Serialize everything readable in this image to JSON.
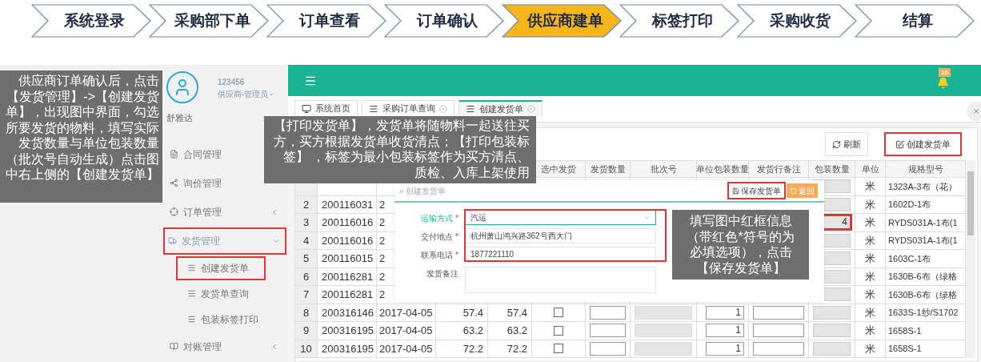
{
  "process_steps": [
    {
      "label": "系统登录",
      "selected": false
    },
    {
      "label": "采购部下单",
      "selected": false
    },
    {
      "label": "订单查看",
      "selected": false
    },
    {
      "label": "订单确认",
      "selected": false
    },
    {
      "label": "供应商建单",
      "selected": true
    },
    {
      "label": "标签打印",
      "selected": false
    },
    {
      "label": "采购收货",
      "selected": false
    },
    {
      "label": "结算",
      "selected": false
    }
  ],
  "user": {
    "id": "123456",
    "role": "供应商-管理员",
    "company": "舒雅达"
  },
  "sidebar": {
    "items": [
      {
        "label": "合同管理",
        "kind": "file",
        "expanded": false,
        "highlighted": false
      },
      {
        "label": "询价管理",
        "kind": "share",
        "expanded": false,
        "highlighted": false
      },
      {
        "label": "订单管理",
        "kind": "target",
        "collapsible": true,
        "expanded": false,
        "highlighted": false
      },
      {
        "label": "发货管理",
        "kind": "truck",
        "collapsible": true,
        "expanded": true,
        "highlighted": true,
        "children": [
          {
            "label": "创建发货单",
            "highlighted": true
          },
          {
            "label": "发货单查询",
            "highlighted": false
          },
          {
            "label": "包装标签打印",
            "highlighted": false
          }
        ]
      },
      {
        "label": "对账管理",
        "kind": "book",
        "collapsible": true,
        "expanded": false,
        "highlighted": false
      }
    ]
  },
  "header": {
    "notification_count": "10"
  },
  "tabs": [
    {
      "label": "系统首页",
      "kind": "home",
      "closable": false,
      "selected": false
    },
    {
      "label": "采购订单查询",
      "kind": "list",
      "closable": true,
      "selected": false
    },
    {
      "label": "创建发货单",
      "kind": "list",
      "closable": true,
      "selected": true
    }
  ],
  "toolbar": [
    {
      "label": "刷新",
      "kind": "refresh",
      "highlighted": false
    },
    {
      "label": "创建发货单",
      "kind": "edit",
      "highlighted": true
    }
  ],
  "table": {
    "columns": [
      {
        "label": "选中发货"
      },
      {
        "label": "发货数量"
      },
      {
        "label": "批次号"
      },
      {
        "label": "单位包装数量"
      },
      {
        "label": "发货行备注"
      },
      {
        "label": "包装数量"
      },
      {
        "label": "单位"
      },
      {
        "label": "规格型号"
      }
    ],
    "rows": [
      {
        "unit": "米",
        "spec": "1323A-3布（花）",
        "pack_highlighted": false
      },
      {
        "no": "2",
        "code": "200116031",
        "date": "2",
        "unit": "米",
        "spec": "1602D-1布",
        "pack_highlighted": false
      },
      {
        "no": "3",
        "code": "200116016",
        "date": "2",
        "pack_qty": "4",
        "unit": "米",
        "spec": "RYDS031A-1布(1",
        "pack_highlighted": true
      },
      {
        "no": "4",
        "code": "200116016",
        "date": "2",
        "unit": "米",
        "spec": "RYDS031A-1布(1",
        "pack_highlighted": false
      },
      {
        "no": "5",
        "code": "200116015",
        "date": "2",
        "unit": "米",
        "spec": "1603C-1布",
        "pack_highlighted": false
      },
      {
        "no": "6",
        "code": "200116281",
        "date": "2",
        "unit": "米",
        "spec": "1630B-6布（绿格",
        "pack_highlighted": false
      },
      {
        "no": "7",
        "code": "200116281",
        "date": "2",
        "unit": "米",
        "spec": "1630B-6布（绿格",
        "pack_highlighted": false
      },
      {
        "no": "8",
        "code": "200316146",
        "date": "2017-04-05",
        "qty_a": "57.4",
        "qty_b": "57.4",
        "checked": false,
        "unit_pack": "1",
        "unit": "米",
        "spec": "1633S-1纱/S1702",
        "pack_highlighted": false
      },
      {
        "no": "9",
        "code": "200316195",
        "date": "2017-04-05",
        "qty_a": "63.2",
        "qty_b": "63.2",
        "checked": false,
        "unit_pack": "1",
        "unit": "米",
        "spec": "1658S-1",
        "pack_highlighted": false
      },
      {
        "no": "10",
        "code": "200316195",
        "date": "2017-04-05",
        "qty_a": "72.2",
        "qty_b": "72.2",
        "checked": false,
        "unit_pack": "1",
        "unit": "米",
        "spec": "1658S-1",
        "pack_highlighted": false
      }
    ]
  },
  "dialog": {
    "breadcrumb": "» 创建发货单",
    "buttons": [
      {
        "label": "保存发货单",
        "kind": "save",
        "highlighted": true
      },
      {
        "label": "返回",
        "kind": "back",
        "highlighted": false
      }
    ],
    "fields": [
      {
        "label": "运输方式",
        "required_mark": "*",
        "kind": "select",
        "value": "汽运",
        "focused": true
      },
      {
        "label": "交付地点",
        "required_mark": "*",
        "kind": "input",
        "value": "杭州萧山鸿兴路362号西大门",
        "focused": false
      },
      {
        "label": "联系电话",
        "required_mark": "*",
        "kind": "input",
        "value": "1877221110",
        "focused": false
      },
      {
        "label": "发货备注",
        "kind": "textarea",
        "focused": false
      }
    ]
  },
  "callouts": [
    "供应商订单确认后，点击【发货管理】->【创建发货单】，出现图中界面，勾选所要发货的物料，填写实际发货数量与单位包装数量（批次号自动生成）点击图中右上侧的【创建发货单】",
    "【打印发货单】，发货单将随物料一起送往买方，买方根据发货单收货清点；【打印包装标签】 ，标签为最小包装标签作为买方清点、质检、入库上架使用",
    "填写图中红框信息（带红色*符号的为必填选项），点击【保存发货单】"
  ]
}
